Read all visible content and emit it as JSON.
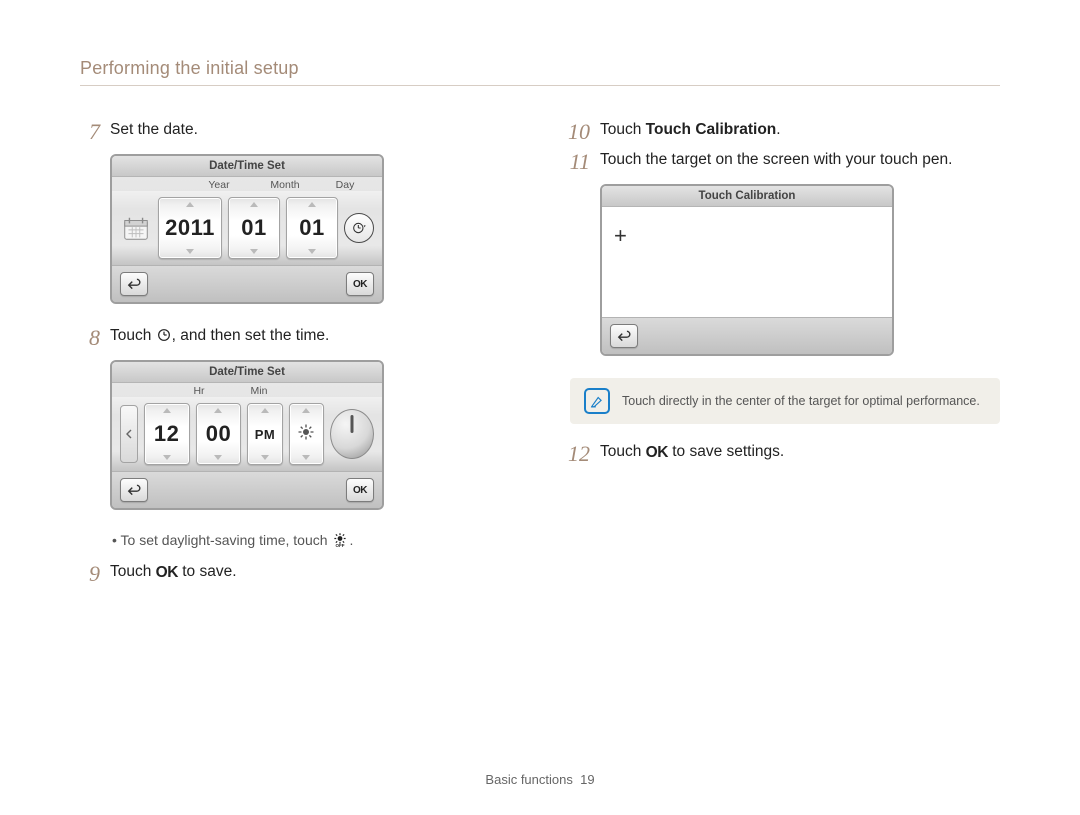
{
  "page": {
    "header": "Performing the initial setup",
    "footer_section": "Basic functions",
    "footer_page": "19"
  },
  "steps": {
    "s7": {
      "num": "7",
      "text": "Set the date."
    },
    "s8": {
      "num": "8",
      "text_before": "Touch ",
      "text_after": ", and then set the time."
    },
    "s8_sub": "To set daylight-saving time, touch ",
    "s9": {
      "num": "9",
      "text_before": "Touch ",
      "ok": "OK",
      "text_after": " to save."
    },
    "s10": {
      "num": "10",
      "text_before": "Touch ",
      "bold": "Touch Calibration",
      "text_after": "."
    },
    "s11": {
      "num": "11",
      "text": "Touch the target on the screen with your touch pen."
    },
    "s12": {
      "num": "12",
      "text_before": "Touch ",
      "ok": "OK",
      "text_after": " to save settings."
    }
  },
  "figure_date": {
    "title": "Date/Time Set",
    "labels": {
      "year": "Year",
      "month": "Month",
      "day": "Day"
    },
    "values": {
      "year": "2011",
      "month": "01",
      "day": "01"
    },
    "ok": "OK"
  },
  "figure_time": {
    "title": "Date/Time Set",
    "labels": {
      "hr": "Hr",
      "min": "Min"
    },
    "values": {
      "hr": "12",
      "min": "00",
      "ampm": "PM"
    },
    "ok": "OK"
  },
  "figure_tc": {
    "title": "Touch Calibration"
  },
  "note": {
    "text": "Touch directly in the center of the target for optimal performance."
  }
}
